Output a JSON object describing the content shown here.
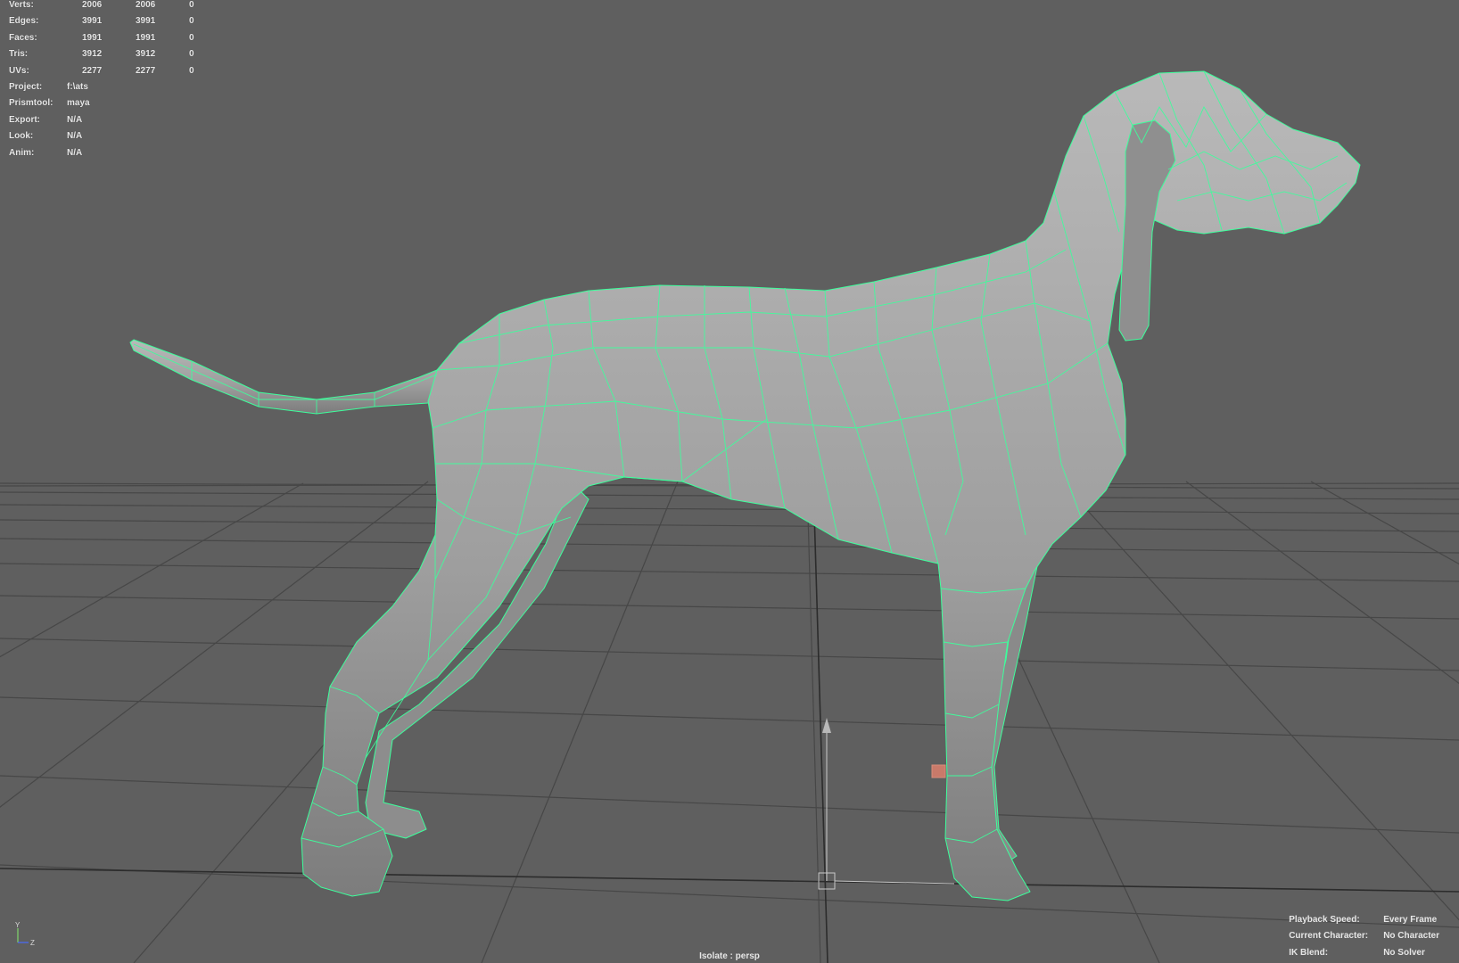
{
  "stats": [
    {
      "label": "Verts:",
      "v1": "2006",
      "v2": "2006",
      "v3": "0"
    },
    {
      "label": "Edges:",
      "v1": "3991",
      "v2": "3991",
      "v3": "0"
    },
    {
      "label": "Faces:",
      "v1": "1991",
      "v2": "1991",
      "v3": "0"
    },
    {
      "label": "Tris:",
      "v1": "3912",
      "v2": "3912",
      "v3": "0"
    },
    {
      "label": "UVs:",
      "v1": "2277",
      "v2": "2277",
      "v3": "0"
    }
  ],
  "info": [
    {
      "label": "Project:",
      "value": "f:\\ats"
    },
    {
      "label": "Prismtool:",
      "value": "maya"
    },
    {
      "label": "Export:",
      "value": "N/A"
    },
    {
      "label": "Look:",
      "value": "N/A"
    },
    {
      "label": "Anim:",
      "value": "N/A"
    }
  ],
  "playback": [
    {
      "label": "Playback Speed:",
      "value": "Every Frame"
    },
    {
      "label": "Current Character:",
      "value": "No Character"
    },
    {
      "label": "IK Blend:",
      "value": "No Solver"
    }
  ],
  "isolate_label": "Isolate : persp",
  "axis": {
    "y": "Y",
    "z": "Z"
  },
  "colors": {
    "background": "#5f5f5f",
    "wireframe": "#3dff9c",
    "mesh": "#a9a9a9",
    "grid": "#3f3f3f",
    "selected_face": "#c97a6a"
  }
}
